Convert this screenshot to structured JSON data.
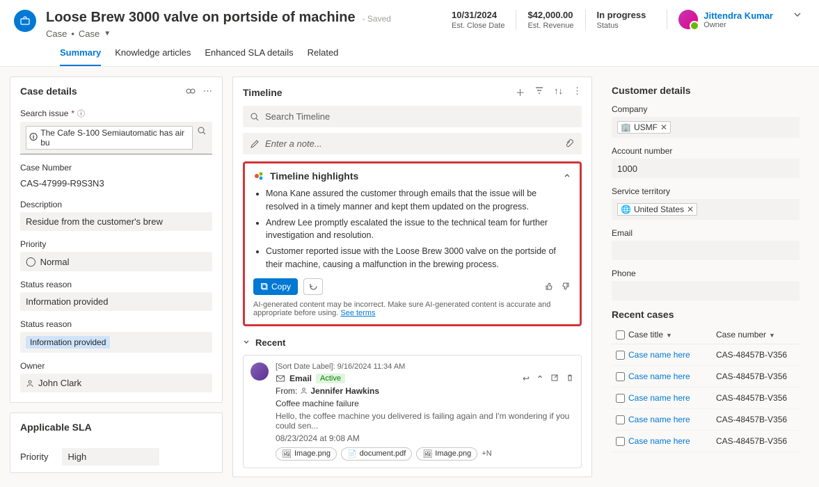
{
  "header": {
    "title": "Loose Brew 3000 valve on portside of machine",
    "saved": "- Saved",
    "entity": "Case",
    "subentity": "Case",
    "metrics": [
      {
        "value": "10/31/2024",
        "label": "Est. Close Date"
      },
      {
        "value": "$42,000.00",
        "label": "Est. Revenue"
      },
      {
        "value": "In progress",
        "label": "Status"
      }
    ],
    "owner": {
      "name": "Jittendra Kumar",
      "label": "Owner"
    }
  },
  "tabs": [
    "Summary",
    "Knowledge articles",
    "Enhanced SLA details",
    "Related"
  ],
  "case_details": {
    "title": "Case details",
    "search_issue_label": "Search issue",
    "search_issue_value": "The Cafe S-100 Semiautomatic has air bu",
    "case_number_label": "Case Number",
    "case_number": "CAS-47999-R9S3N3",
    "description_label": "Description",
    "description": "Residue from the customer's brew",
    "priority_label": "Priority",
    "priority": "Normal",
    "status_reason_label": "Status reason",
    "status_reason": "Information provided",
    "status_reason2_label": "Status reason",
    "status_reason2": "Information provided",
    "owner_label": "Owner",
    "owner": "John Clark"
  },
  "sla": {
    "title": "Applicable SLA",
    "priority_label": "Priority",
    "priority_value": "High"
  },
  "timeline": {
    "title": "Timeline",
    "search_placeholder": "Search Timeline",
    "note_placeholder": "Enter a note...",
    "highlights": {
      "title": "Timeline highlights",
      "items": [
        "Mona Kane assured the customer through emails that the issue will be resolved in a timely manner and kept them updated on the progress.",
        "Andrew Lee promptly escalated the issue to the technical team for further investigation and resolution.",
        "Customer reported issue with the Loose Brew 3000 valve on the portside of their machine, causing a malfunction in the brewing process."
      ],
      "copy": "Copy",
      "disclaimer": "AI-generated content may be incorrect. Make sure AI-generated content is accurate and appropriate before using.",
      "see_terms": "See terms"
    },
    "recent_label": "Recent",
    "email": {
      "sort_label": "[Sort Date Label]: 9/16/2024 11:34 AM",
      "type": "Email",
      "status": "Active",
      "from_label": "From:",
      "from": "Jennifer Hawkins",
      "subject": "Coffee machine failure",
      "preview": "Hello, the coffee machine you delivered is failing again and I'm wondering if you could sen...",
      "date": "08/23/2024 at 9:08 AM",
      "attachments": [
        "Image.png",
        "document.pdf",
        "Image.png"
      ],
      "attach_more": "+N"
    }
  },
  "customer": {
    "title": "Customer details",
    "company_label": "Company",
    "company": "USMF",
    "account_label": "Account number",
    "account": "1000",
    "territory_label": "Service territory",
    "territory": "United States",
    "email_label": "Email",
    "email": "",
    "phone_label": "Phone",
    "phone": "",
    "recent_title": "Recent cases",
    "col_title": "Case title",
    "col_number": "Case number",
    "cases": [
      {
        "name": "Case name here",
        "num": "CAS-48457B-V356"
      },
      {
        "name": "Case name here",
        "num": "CAS-48457B-V356"
      },
      {
        "name": "Case name here",
        "num": "CAS-48457B-V356"
      },
      {
        "name": "Case name here",
        "num": "CAS-48457B-V356"
      },
      {
        "name": "Case name here",
        "num": "CAS-48457B-V356"
      }
    ]
  }
}
